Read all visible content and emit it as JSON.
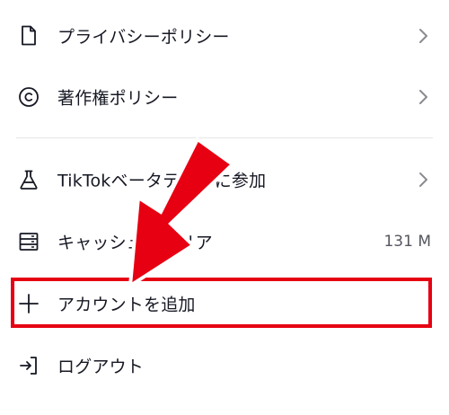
{
  "menu": {
    "privacy": {
      "label": "プライバシーポリシー",
      "icon": "document-icon"
    },
    "copyright": {
      "label": "著作権ポリシー",
      "icon": "copyright-icon"
    },
    "beta": {
      "label": "TikTokベータテストに参加",
      "icon": "flask-icon"
    },
    "cache": {
      "label": "キャッシュをクリア",
      "icon": "storage-icon",
      "value": "131 M"
    },
    "add_account": {
      "label": "アカウントを追加",
      "icon": "plus-icon"
    },
    "logout": {
      "label": "ログアウト",
      "icon": "logout-icon"
    }
  },
  "colors": {
    "highlight": "#e60012",
    "text": "#161823",
    "muted": "#55575e"
  }
}
